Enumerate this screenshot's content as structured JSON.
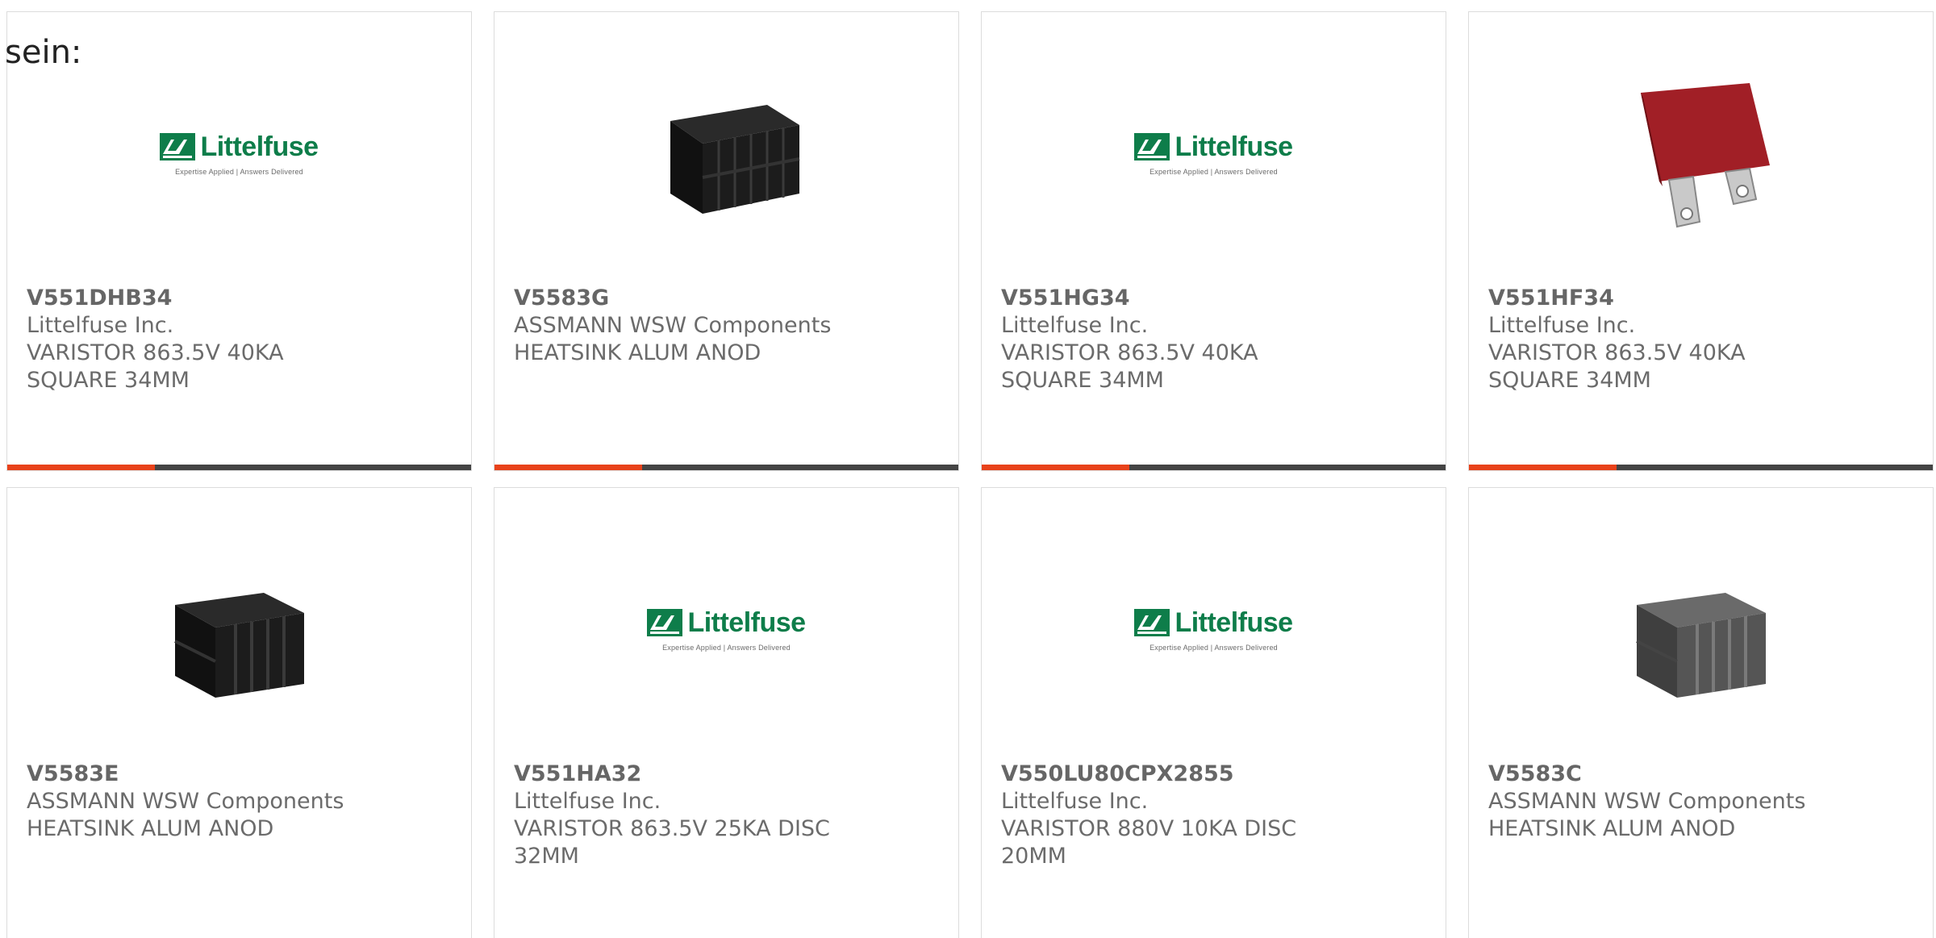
{
  "page_text": "sein:",
  "logo": {
    "word": "Littelfuse",
    "tagline": "Expertise Applied | Answers Delivered"
  },
  "colors": {
    "accent": "#e8421a",
    "bar": "#444444",
    "brand_green": "#0e7d4a",
    "text": "#6b6b6b"
  },
  "products": [
    {
      "part": "V551DHB34",
      "manufacturer": "Littelfuse Inc.",
      "description": "VARISTOR 863.5V 40KA SQUARE 34MM",
      "image": "littelfuse-logo"
    },
    {
      "part": "V5583G",
      "manufacturer": "ASSMANN WSW Components",
      "description": "HEATSINK ALUM ANOD",
      "image": "black-heatsink"
    },
    {
      "part": "V551HG34",
      "manufacturer": "Littelfuse Inc.",
      "description": "VARISTOR 863.5V 40KA SQUARE 34MM",
      "image": "littelfuse-logo"
    },
    {
      "part": "V551HF34",
      "manufacturer": "Littelfuse Inc.",
      "description": "VARISTOR 863.5V 40KA SQUARE 34MM",
      "image": "red-square-varistor"
    },
    {
      "part": "V5583E",
      "manufacturer": "ASSMANN WSW Components",
      "description": "HEATSINK ALUM ANOD",
      "image": "black-heatsink"
    },
    {
      "part": "V551HA32",
      "manufacturer": "Littelfuse Inc.",
      "description": "VARISTOR 863.5V 25KA DISC 32MM",
      "image": "littelfuse-logo"
    },
    {
      "part": "V550LU80CPX2855",
      "manufacturer": "Littelfuse Inc.",
      "description": "VARISTOR 880V 10KA DISC 20MM",
      "image": "littelfuse-logo"
    },
    {
      "part": "V5583C",
      "manufacturer": "ASSMANN WSW Components",
      "description": "HEATSINK ALUM ANOD",
      "image": "gray-heatsink"
    }
  ]
}
